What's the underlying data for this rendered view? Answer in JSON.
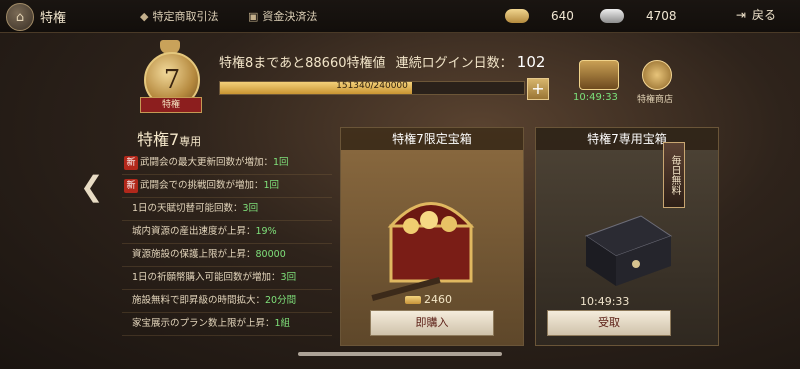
{
  "header": {
    "title": "特権",
    "tabs": [
      {
        "label": "特定商取引法",
        "icon": "shield-icon"
      },
      {
        "label": "資金決済法",
        "icon": "book-icon"
      }
    ],
    "resources": [
      {
        "name": "gold",
        "value": "640",
        "color": "#d9b56a"
      },
      {
        "name": "silver",
        "value": "4708",
        "color": "#c9c9c9"
      }
    ],
    "back_label": "戻る"
  },
  "vip": {
    "rank": "7",
    "rank_label": "特権",
    "status_text": "特権8まであと88660特権値",
    "login_label": "連続ログイン日数：",
    "login_days": "102",
    "progress_text": "151340/240000",
    "progress_fraction": 0.63
  },
  "top_icons": {
    "timer": "10:49:33",
    "shop_label": "特権商店"
  },
  "panel": {
    "title_main": "特権7",
    "title_sub": "専用",
    "benefits": [
      {
        "new": "新",
        "text": "武闘会の最大更新回数が増加：",
        "value": "1回"
      },
      {
        "new": "新",
        "text": "武闘会での挑戦回数が増加：",
        "value": "1回"
      },
      {
        "new": "",
        "text": "1日の天賦切替可能回数：",
        "value": "3回"
      },
      {
        "new": "",
        "text": "城内資源の産出速度が上昇：",
        "value": "19%"
      },
      {
        "new": "",
        "text": "資源施設の保護上限が上昇：",
        "value": "80000"
      },
      {
        "new": "",
        "text": "1日の祈願幣購入可能回数が増加：",
        "value": "3回"
      },
      {
        "new": "",
        "text": "施設無料で即昇級の時間拡大：",
        "value": "20分間"
      },
      {
        "new": "",
        "text": "家宝展示のプラン数上限が上昇：",
        "value": "1組"
      }
    ]
  },
  "cards": [
    {
      "title": "特権7限定宝箱",
      "price": "2460",
      "button": "即購入"
    },
    {
      "title": "特権7専用宝箱",
      "tag": "毎日無料",
      "timer": "10:49:33",
      "button": "受取"
    }
  ]
}
